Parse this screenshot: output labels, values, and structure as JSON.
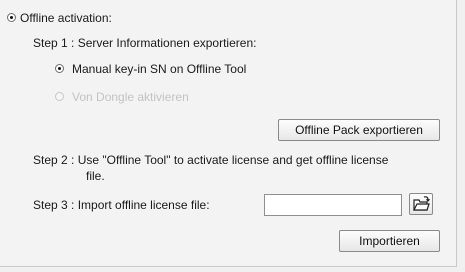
{
  "offline_activation": {
    "label": "Offline activation:",
    "selected": true
  },
  "step1": {
    "label": "Step 1 : Server Informationen exportieren:",
    "options": [
      {
        "label": "Manual key-in SN on Offline Tool",
        "selected": true,
        "enabled": true
      },
      {
        "label": "Von Dongle aktivieren",
        "selected": false,
        "enabled": false
      }
    ],
    "export_button": "Offline Pack exportieren"
  },
  "step2": {
    "line1": "Step 2 : Use \"Offline Tool\" to activate license and get offline license",
    "line2": "file."
  },
  "step3": {
    "label": "Step 3 : Import offline license file:",
    "file_value": "",
    "browse_icon": "folder-open-icon",
    "import_button": "Importieren"
  }
}
